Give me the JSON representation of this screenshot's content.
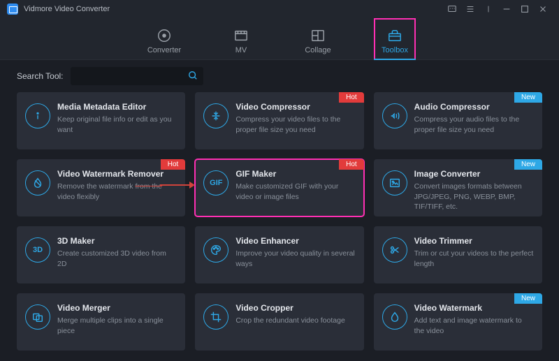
{
  "app": {
    "title": "Vidmore Video Converter"
  },
  "nav": {
    "converter": "Converter",
    "mv": "MV",
    "collage": "Collage",
    "toolbox": "Toolbox"
  },
  "search": {
    "label": "Search Tool:",
    "placeholder": ""
  },
  "badges": {
    "hot": "Hot",
    "new": "New"
  },
  "tools": {
    "metadata": {
      "title": "Media Metadata Editor",
      "desc": "Keep original file info or edit as you want"
    },
    "vcompress": {
      "title": "Video Compressor",
      "desc": "Compress your video files to the proper file size you need"
    },
    "acompress": {
      "title": "Audio Compressor",
      "desc": "Compress your audio files to the proper file size you need"
    },
    "watermarkrm": {
      "title": "Video Watermark Remover",
      "desc_a": "Remove the watermark ",
      "desc_strike": "from the",
      "desc_b": " video flexibly"
    },
    "gif": {
      "title": "GIF Maker",
      "desc": "Make customized GIF with your video or image files",
      "icon_text": "GIF"
    },
    "imgconv": {
      "title": "Image Converter",
      "desc": "Convert images formats between JPG/JPEG, PNG, WEBP, BMP, TIF/TIFF, etc."
    },
    "3d": {
      "title": "3D Maker",
      "desc": "Create customized 3D video from 2D",
      "icon_text": "3D"
    },
    "enhancer": {
      "title": "Video Enhancer",
      "desc": "Improve your video quality in several ways"
    },
    "trimmer": {
      "title": "Video Trimmer",
      "desc": "Trim or cut your videos to the perfect length"
    },
    "merger": {
      "title": "Video Merger",
      "desc": "Merge multiple clips into a single piece"
    },
    "cropper": {
      "title": "Video Cropper",
      "desc": "Crop the redundant video footage"
    },
    "vwatermark": {
      "title": "Video Watermark",
      "desc": "Add text and image watermark to the video"
    }
  }
}
